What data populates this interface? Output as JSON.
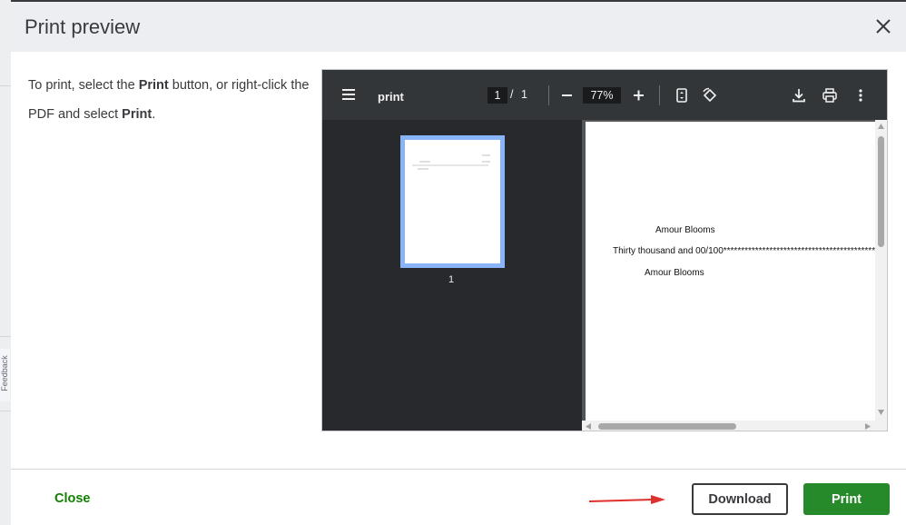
{
  "dialog": {
    "title": "Print preview",
    "close_icon": "close-icon"
  },
  "background": {
    "feedback_label": "Feedback"
  },
  "instructions": {
    "part1": "To print, select the ",
    "bold1": "Print",
    "part2": " button, or right-click the PDF and select ",
    "bold2": "Print",
    "part3": "."
  },
  "pdf_viewer": {
    "doc_title": "print",
    "current_page": "1",
    "page_separator": "/",
    "total_pages": "1",
    "zoom": "77%",
    "toolbar_icons": [
      "menu-icon",
      "zoom-out-icon",
      "zoom-in-icon",
      "fit-page-icon",
      "rotate-icon",
      "download-icon",
      "print-icon",
      "more-options-icon"
    ],
    "thumbnail_label": "1",
    "document_lines": [
      "Amour Blooms",
      "Thirty thousand and 00/100*************************************************",
      "Amour Blooms"
    ]
  },
  "footer": {
    "close_label": "Close",
    "download_label": "Download",
    "print_label": "Print",
    "accent_color": "#2ca01c"
  }
}
